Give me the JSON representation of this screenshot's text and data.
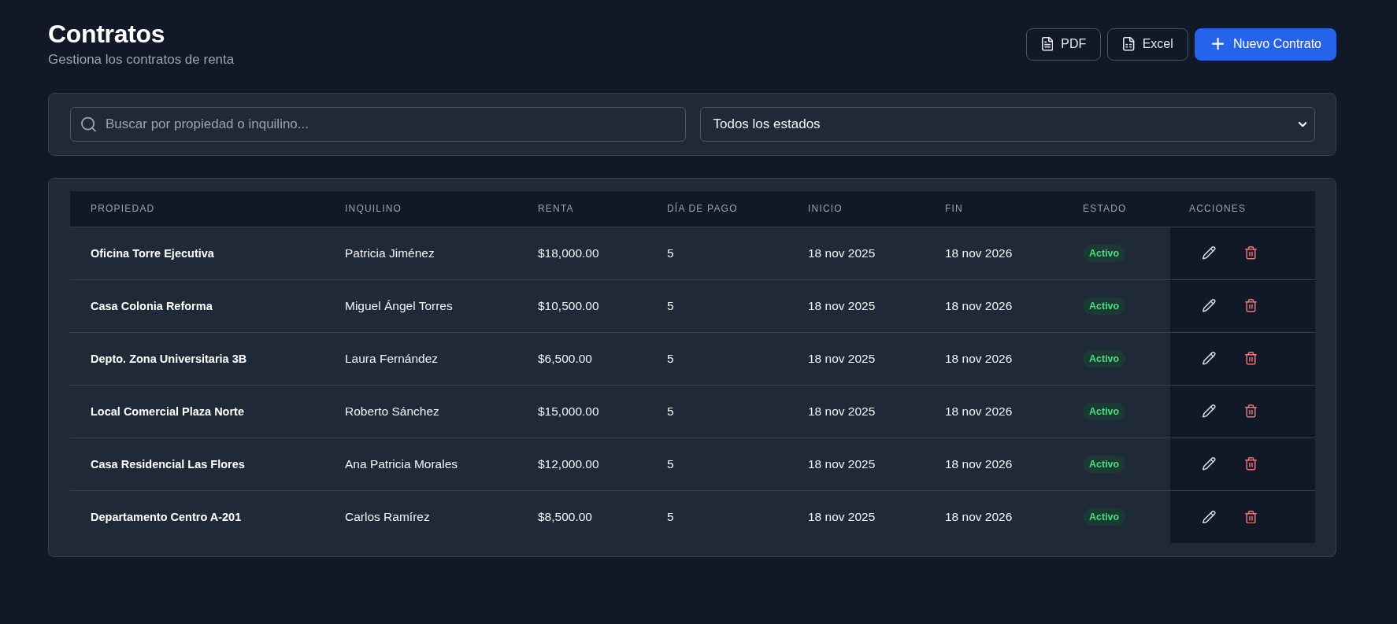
{
  "header": {
    "title": "Contratos",
    "subtitle": "Gestiona los contratos de renta"
  },
  "actions": [
    {
      "kind": "pdf",
      "label": "PDF"
    },
    {
      "kind": "excel",
      "label": "Excel"
    },
    {
      "kind": "create",
      "label": "Nuevo Contrato"
    }
  ],
  "filters": {
    "search": {
      "placeholder": "Buscar por propiedad o inquilino..."
    },
    "status_filter": {
      "value": "Todos los estados"
    }
  },
  "table": {
    "columns": [
      "PROPIEDAD",
      "INQUILINO",
      "RENTA",
      "DÍA DE PAGO",
      "INICIO",
      "FIN",
      "ESTADO",
      "ACCIONES"
    ],
    "rows": [
      {
        "property": "Oficina Torre Ejecutiva",
        "tenant": "Patricia Jiménez",
        "rent": "$18,000.00",
        "pay_day": "5",
        "start": "18 nov 2025",
        "end": "18 nov 2026",
        "status": {
          "kind": "active",
          "label": "Activo"
        }
      },
      {
        "property": "Casa Colonia Reforma",
        "tenant": "Miguel Ángel Torres",
        "rent": "$10,500.00",
        "pay_day": "5",
        "start": "18 nov 2025",
        "end": "18 nov 2026",
        "status": {
          "kind": "active",
          "label": "Activo"
        }
      },
      {
        "property": "Depto. Zona Universitaria 3B",
        "tenant": "Laura Fernández",
        "rent": "$6,500.00",
        "pay_day": "5",
        "start": "18 nov 2025",
        "end": "18 nov 2026",
        "status": {
          "kind": "active",
          "label": "Activo"
        }
      },
      {
        "property": "Local Comercial Plaza Norte",
        "tenant": "Roberto Sánchez",
        "rent": "$15,000.00",
        "pay_day": "5",
        "start": "18 nov 2025",
        "end": "18 nov 2026",
        "status": {
          "kind": "active",
          "label": "Activo"
        }
      },
      {
        "property": "Casa Residencial Las Flores",
        "tenant": "Ana Patricia Morales",
        "rent": "$12,000.00",
        "pay_day": "5",
        "start": "18 nov 2025",
        "end": "18 nov 2026",
        "status": {
          "kind": "active",
          "label": "Activo"
        }
      },
      {
        "property": "Departamento Centro A-201",
        "tenant": "Carlos Ramírez",
        "rent": "$8,500.00",
        "pay_day": "5",
        "start": "18 nov 2025",
        "end": "18 nov 2026",
        "status": {
          "kind": "active",
          "label": "Activo"
        }
      }
    ]
  }
}
